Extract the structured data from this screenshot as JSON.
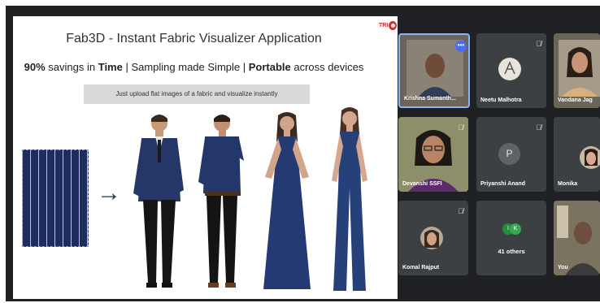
{
  "slide": {
    "title": "Fab3D - Instant Fabric Visualizer Application",
    "logo_text": "TRI",
    "subtitle_p1": "90%",
    "subtitle_p2": " savings in ",
    "subtitle_p3": "Time",
    "subtitle_p4": "  |  Sampling made Simple | ",
    "subtitle_p5": "Portable",
    "subtitle_p6": " across devices",
    "banner": "Just upload flat images of a fabric and visualize instantly",
    "arrow": "→"
  },
  "participants": [
    {
      "name": "Krishna Sumanth...",
      "muted": false,
      "more_badge": "•••"
    },
    {
      "name": "Neetu Malhotra",
      "muted": true
    },
    {
      "name": "Vandana Jag",
      "muted": false
    },
    {
      "name": "Devanshi SSFI",
      "muted": true
    },
    {
      "name": "Priyanshi Anand",
      "muted": true,
      "letter": "P"
    },
    {
      "name": "Monika",
      "muted": false
    },
    {
      "name": "Komal Rajput",
      "muted": true
    },
    {
      "name": "41 others",
      "circle_a": "I",
      "circle_b": "K"
    },
    {
      "name": "You",
      "muted": false
    }
  ],
  "icons": {
    "mic_off": "mic-off-icon",
    "more": "more-options-icon"
  },
  "colors": {
    "meet_bg": "#202124",
    "tile_bg": "#3c4043",
    "fabric_navy": "#1e2d5c"
  }
}
